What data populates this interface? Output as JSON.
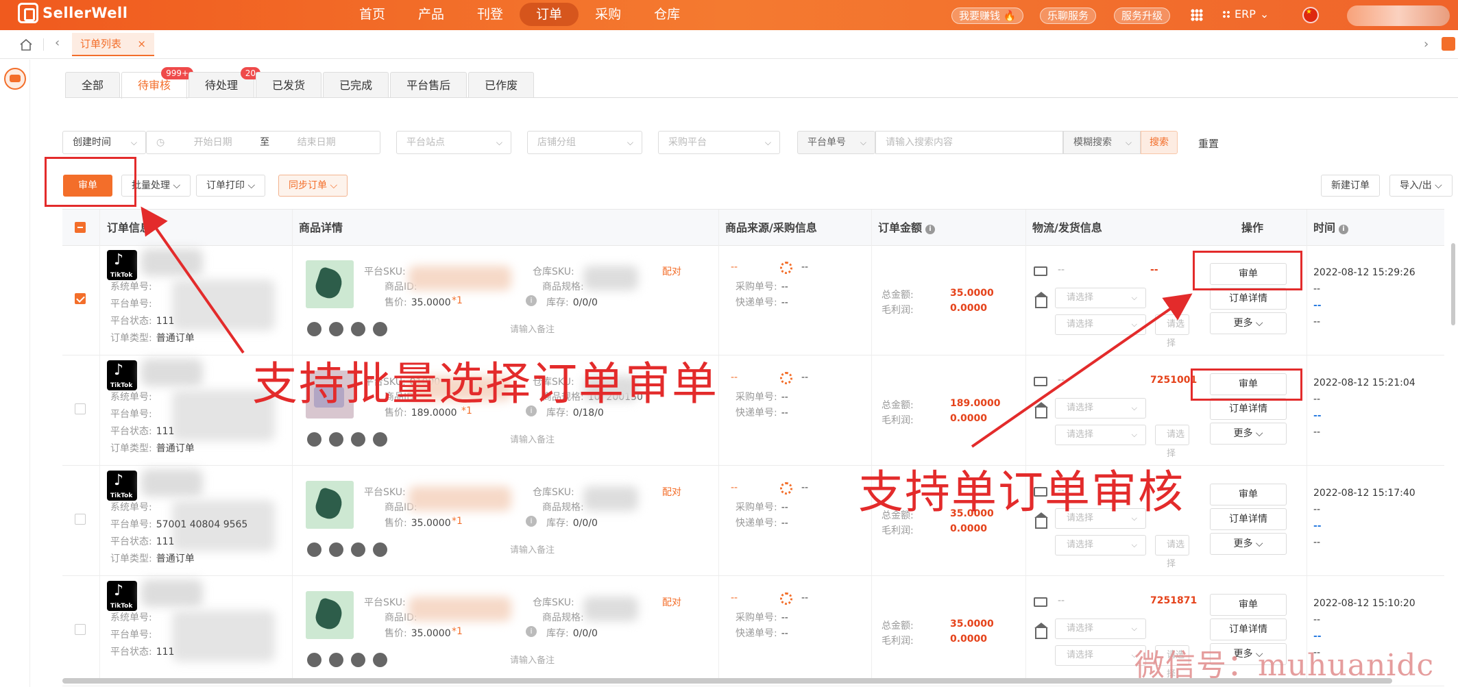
{
  "brand": {
    "name": "SellerWell"
  },
  "nav": {
    "items": [
      "首页",
      "产品",
      "刊登",
      "订单",
      "采购",
      "仓库"
    ],
    "active": "订单"
  },
  "top_right": {
    "earn": "我要赚钱",
    "lelian": "乐聊服务",
    "upgrade": "服务升级",
    "erp": "ERP"
  },
  "page_tab": {
    "label": "订单列表",
    "close": "×"
  },
  "status_tabs": [
    {
      "label": "全部",
      "badge": ""
    },
    {
      "label": "待审核",
      "badge": "999+"
    },
    {
      "label": "待处理",
      "badge": "20"
    },
    {
      "label": "已发货",
      "badge": ""
    },
    {
      "label": "已完成",
      "badge": ""
    },
    {
      "label": "平台售后",
      "badge": ""
    },
    {
      "label": "已作废",
      "badge": ""
    }
  ],
  "filters": {
    "time_type": "创建时间",
    "start_placeholder": "开始日期",
    "to": "至",
    "end_placeholder": "结束日期",
    "site_placeholder": "平台站点",
    "shop_group_placeholder": "店铺分组",
    "purchase_platform_placeholder": "采购平台",
    "search_field": "平台单号",
    "search_placeholder": "请输入搜索内容",
    "match_mode": "模糊搜索",
    "search_label": "搜索",
    "reset_label": "重置"
  },
  "actions": {
    "audit": "审单",
    "batch": "批量处理",
    "print": "订单打印",
    "sync": "同步订单",
    "new_order": "新建订单",
    "import_export": "导入/出"
  },
  "columns": {
    "order_info": "订单信息",
    "product_detail": "商品详情",
    "source": "商品来源/采购信息",
    "amount": "订单金额",
    "logistics": "物流/发货信息",
    "operation": "操作",
    "time": "时间"
  },
  "labels": {
    "sys_no": "系统单号:",
    "platform_no": "平台单号:",
    "platform_status": "平台状态:",
    "order_type": "订单类型:",
    "platform_sku": "平台SKU:",
    "product_id": "商品ID:",
    "price": "售价:",
    "warehouse_sku": "仓库SKU:",
    "product_spec": "商品规格:",
    "stock": "库存:",
    "purchase_no": "采购单号:",
    "express_no": "快递单号:",
    "total": "总金额:",
    "gross_profit": "毛利润:",
    "remark_placeholder": "请输入备注",
    "select_placeholder": "请选择",
    "pair": "配对",
    "detail": "订单详情",
    "more": "更多",
    "tiktok": "TikTok",
    "dash": "--"
  },
  "rows": [
    {
      "checked": true,
      "platform_status": "111",
      "order_type": "普通订单",
      "price": "35.0000",
      "qty": "*1",
      "stock": "0/0/0",
      "total": "35.0000",
      "profit": "0.0000",
      "tracking": "--",
      "time": "2022-08-12 15:29:26",
      "pair": true
    },
    {
      "checked": false,
      "platform_status": "111",
      "order_type": "普通订单",
      "price": "189.0000",
      "qty": "*1",
      "stock": "0/18/0",
      "total": "189.0000",
      "profit": "0.0000",
      "tracking": "7251001",
      "time": "2022-08-12 15:21:04",
      "pair": false,
      "sku_fragment": "01000",
      "spec_fragment": "10, 200150"
    },
    {
      "checked": false,
      "platform_status": "111",
      "order_type": "普通订单",
      "price": "35.0000",
      "qty": "*1",
      "stock": "0/0/0",
      "total": "35.0000",
      "profit": "0.0000",
      "tracking": "",
      "time": "2022-08-12 15:17:40",
      "pair": true,
      "platform_no": "57001 40804 9565"
    },
    {
      "checked": false,
      "platform_status": "111",
      "order_type": "",
      "price": "35.0000",
      "qty": "*1",
      "stock": "0/0/0",
      "total": "35.0000",
      "profit": "0.0000",
      "tracking": "7251871",
      "time": "2022-08-12 15:10:20",
      "pair": true
    }
  ],
  "annotations": {
    "batch": "支持批量选择订单审单",
    "single": "支持单订单审核",
    "watermark": "微信号：muhuanidc"
  },
  "colors": {
    "brand": "#f36e2a",
    "annotation": "#e32b2b",
    "amount": "#e5431b"
  }
}
